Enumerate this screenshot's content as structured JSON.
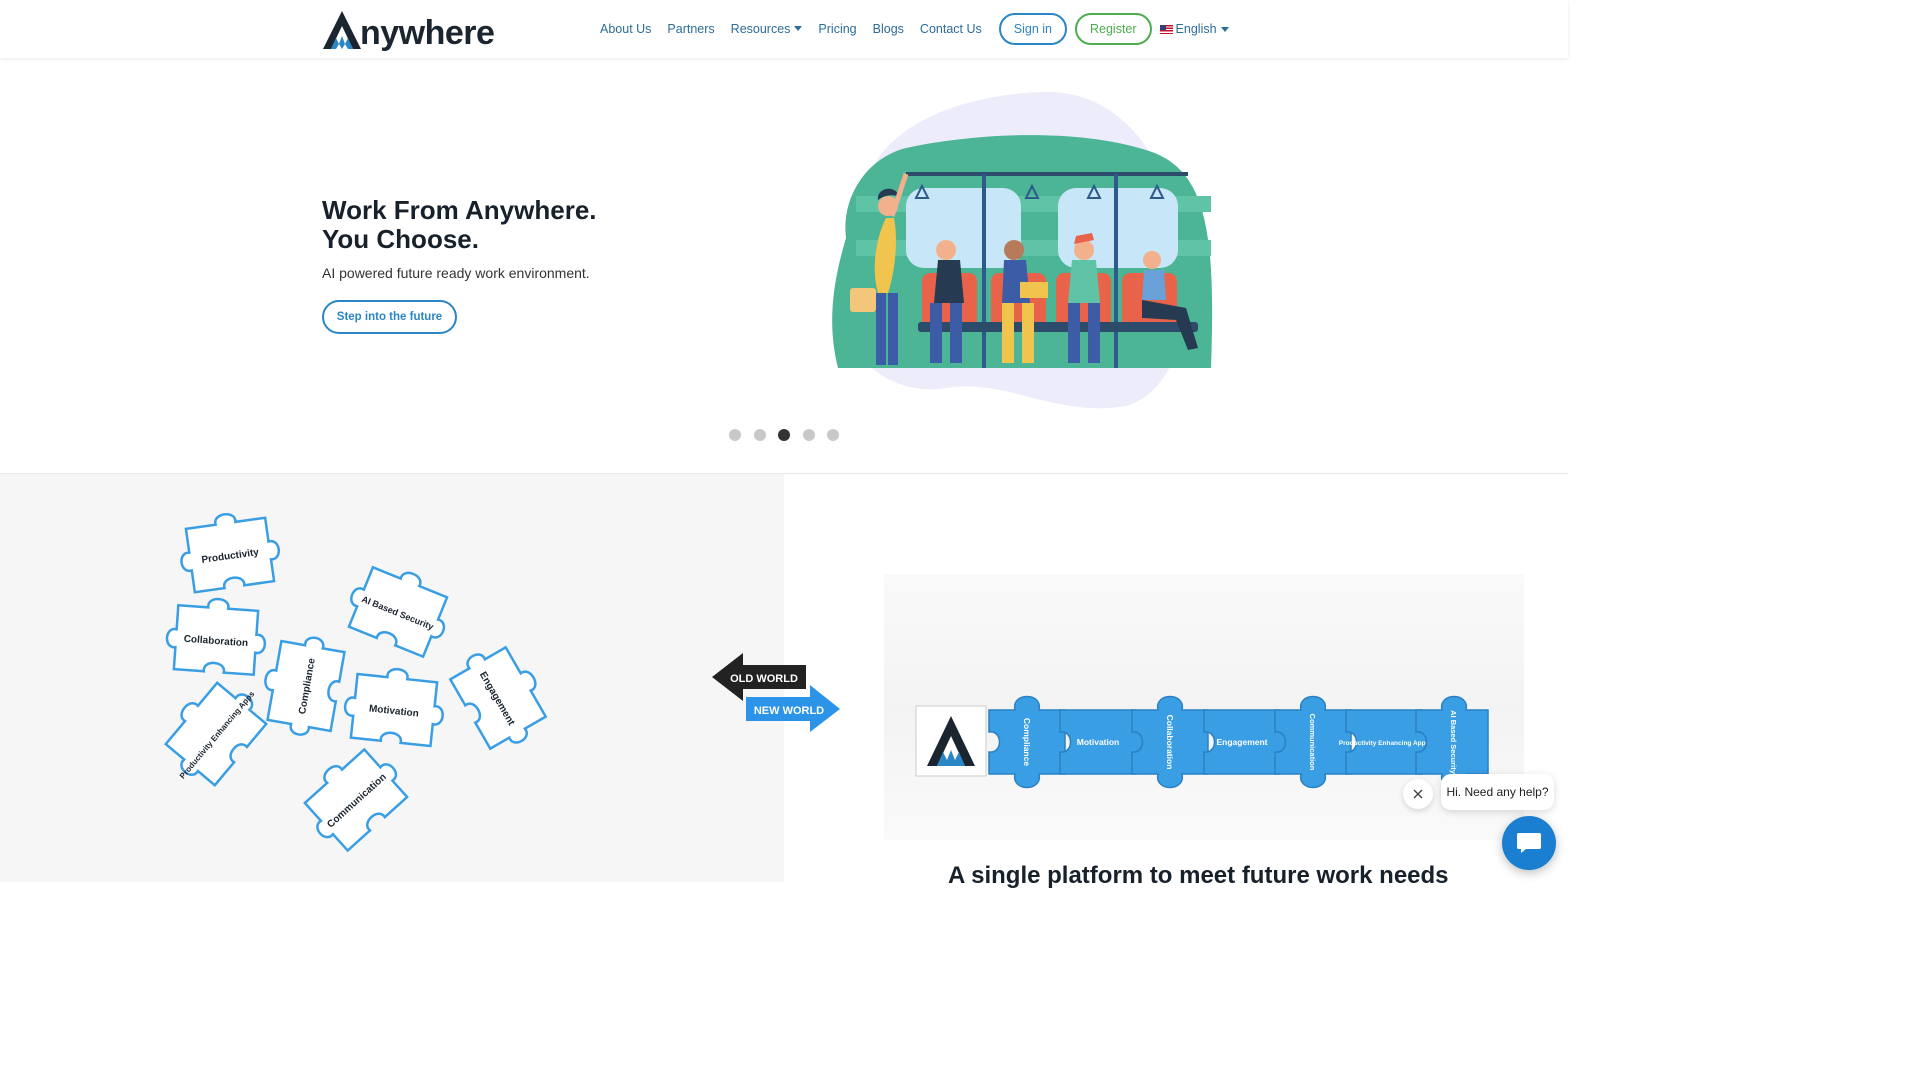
{
  "header": {
    "logo_text": "nywhere",
    "nav": [
      {
        "label": "About Us"
      },
      {
        "label": "Partners"
      },
      {
        "label": "Resources"
      },
      {
        "label": "Pricing"
      },
      {
        "label": "Blogs"
      },
      {
        "label": "Contact Us"
      }
    ],
    "signin_label": "Sign in",
    "register_label": "Register",
    "language_label": "English"
  },
  "hero": {
    "title_line1": "Work From Anywhere.",
    "title_line2": "You Choose.",
    "subtitle": "AI powered future ready work environment.",
    "cta_label": "Step into the future",
    "slides_total": 5,
    "active_slide": 3
  },
  "puzzles": {
    "scattered": [
      "Productivity",
      "AI Based Security",
      "Collaboration",
      "Compliance",
      "Motivation",
      "Engagement",
      "Productivity Enhancing Apps",
      "Communication"
    ],
    "old_world_label": "OLD WORLD",
    "new_world_label": "NEW WORLD",
    "assembled": [
      "Compliance",
      "Motivation",
      "Collaboration",
      "Engagement",
      "Communication",
      "Productivity Enhancing Apps",
      "AI Based Security"
    ]
  },
  "platform_heading": "A single platform to meet future work needs",
  "chat": {
    "prompt": "Hi. Need any help?"
  },
  "colors": {
    "brand_blue": "#2b86c6",
    "register_green": "#4cae4c",
    "puzzle_blue": "#3a9ee4",
    "chat_blue": "#1a7fd0"
  }
}
